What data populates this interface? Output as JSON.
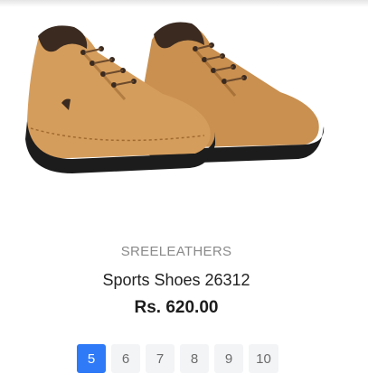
{
  "product": {
    "brand": "SREELEATHERS",
    "title": "Sports Shoes 26312",
    "price": "Rs. 620.00",
    "image_icon": "tan-suede-sports-shoes-image"
  },
  "pagination": {
    "pages": [
      "5",
      "6",
      "7",
      "8",
      "9",
      "10"
    ],
    "active_page": "5",
    "active_color": "#2f7af6"
  }
}
